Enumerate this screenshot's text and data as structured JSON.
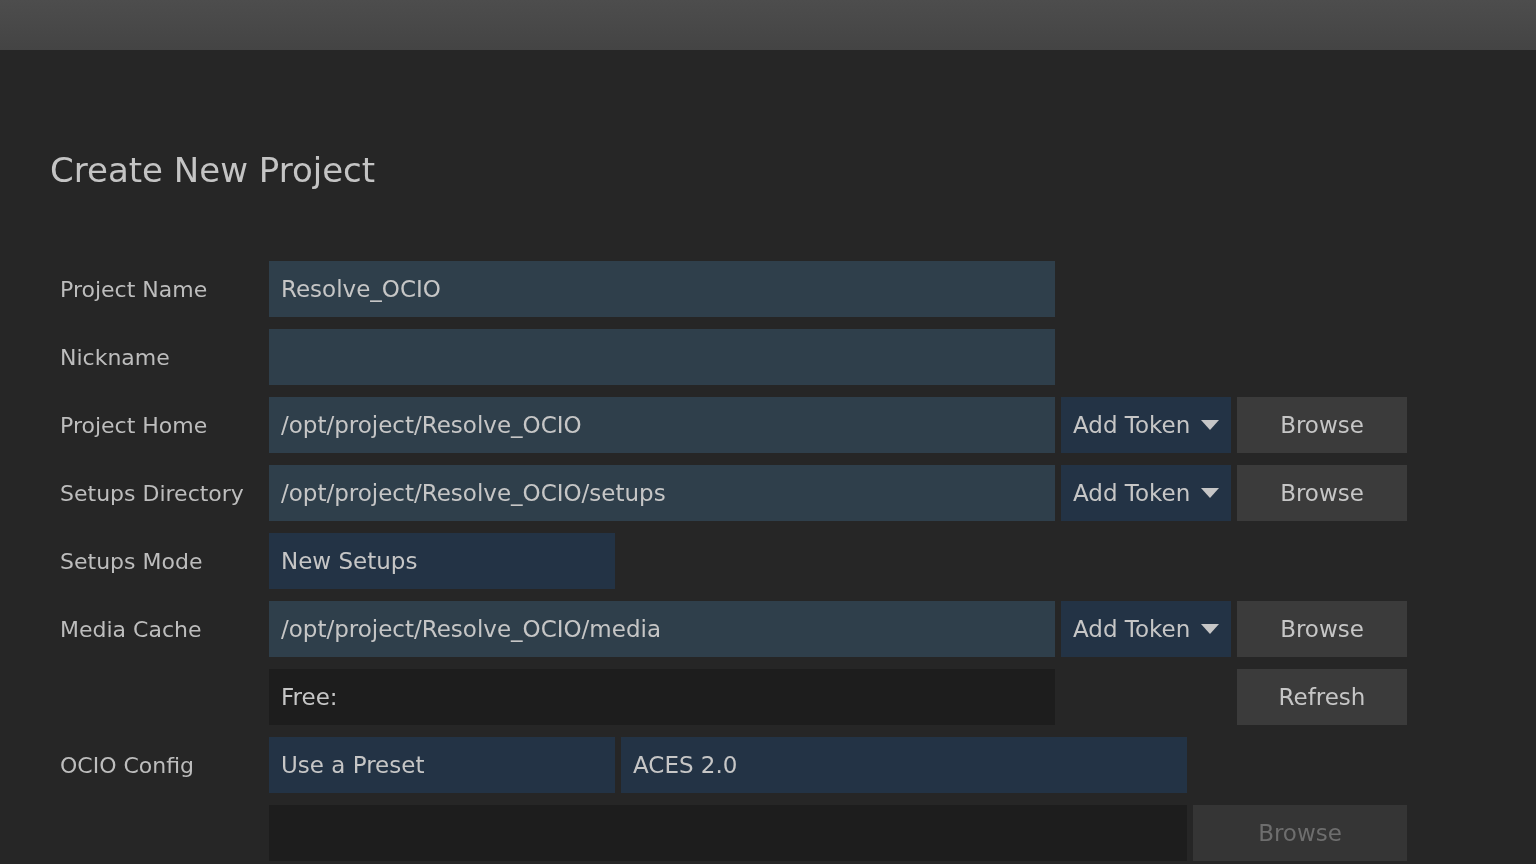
{
  "title": "Create New Project",
  "rows": [
    {
      "label": "Project Name",
      "controls": [
        {
          "kind": "field",
          "value": "Resolve_OCIO"
        }
      ]
    },
    {
      "label": "Nickname",
      "controls": [
        {
          "kind": "field"
        }
      ]
    },
    {
      "label": "Project Home",
      "controls": [
        {
          "kind": "field",
          "value": "/opt/project/Resolve_OCIO"
        },
        {
          "kind": "token",
          "value": "Add Token"
        },
        {
          "kind": "button",
          "value": "Browse",
          "disabled": false
        }
      ]
    },
    {
      "label": "Setups Directory",
      "controls": [
        {
          "kind": "field",
          "value": "/opt/project/Resolve_OCIO/setups"
        },
        {
          "kind": "token",
          "value": "Add Token"
        },
        {
          "kind": "button",
          "value": "Browse",
          "disabled": false
        }
      ]
    },
    {
      "label": "Setups Mode",
      "controls": [
        {
          "kind": "select",
          "value": "New Setups"
        }
      ]
    },
    {
      "label": "Media Cache",
      "controls": [
        {
          "kind": "field",
          "value": "/opt/project/Resolve_OCIO/media"
        },
        {
          "kind": "token",
          "value": "Add Token"
        },
        {
          "kind": "button",
          "value": "Browse",
          "disabled": false
        }
      ]
    },
    {
      "controls": [
        {
          "kind": "readout",
          "value": "Free:"
        },
        {
          "kind": "button",
          "value": "Refresh",
          "disabled": false
        }
      ]
    },
    {
      "label": "OCIO Config",
      "controls": [
        {
          "kind": "select",
          "value": "Use a Preset"
        },
        {
          "kind": "wideselect",
          "value": "ACES 2.0"
        }
      ]
    },
    {
      "controls": [
        {
          "kind": "widereadout"
        },
        {
          "kind": "widebutton",
          "value": "Browse",
          "disabled": true
        }
      ]
    }
  ]
}
